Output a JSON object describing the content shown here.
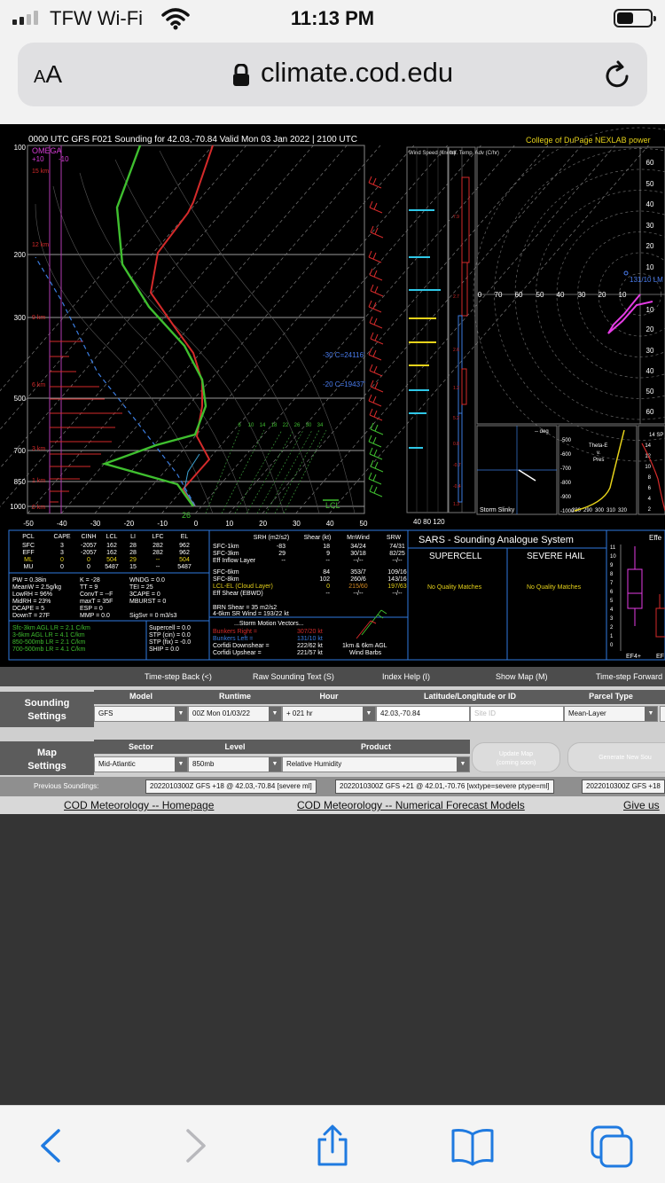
{
  "status_bar": {
    "carrier": "TFW Wi-Fi",
    "time": "11:13 PM",
    "icons": [
      "cellular-signal-icon",
      "wifi-icon",
      "battery-icon"
    ]
  },
  "browser": {
    "text_size_label_small": "A",
    "text_size_label_large": "A",
    "url": "climate.cod.edu",
    "icons": [
      "lock-icon",
      "reload-icon"
    ]
  },
  "sounding": {
    "title": "0000 UTC GFS F021 Sounding for 42.03,-70.84 Valid  Mon 03 Jan 2022 | 2100 UTC",
    "credit": "College of DuPage NEXLAB power",
    "omega_label": "OMEGA",
    "omega_scale": [
      "+10",
      "-10"
    ],
    "height_labels": [
      "15 km",
      "12 km",
      "9 km",
      "6 km",
      "3 km",
      "1 km",
      "0 km"
    ],
    "pressure_labels": [
      "100",
      "200",
      "300",
      "500",
      "700",
      "850",
      "1000"
    ],
    "temp_axis_labels": [
      "-50",
      "-40",
      "-30",
      "-20",
      "-10",
      "0",
      "10",
      "20",
      "30",
      "40",
      "50"
    ],
    "surface_temp": "26",
    "lcl_label": "LCL",
    "levels": [
      "-30 C=24116'",
      "-20 C=19437'"
    ],
    "mixing_ratio_labels": [
      "6",
      "10",
      "14",
      "18",
      "22",
      "26",
      "30",
      "34"
    ],
    "wind_speed_header": "Wind Speed (knots)",
    "wind_speed_axis": "40  80 120",
    "temp_adv_header": "Inf. Temp. Adv (C/hr)",
    "temp_adv_values": [
      "7.9",
      "2.7",
      "2.6",
      "1.2",
      "5.2",
      "0.8",
      "-0.7",
      "-0.4",
      "1.3"
    ],
    "hodograph_ring_labels_right": [
      "60",
      "50",
      "40",
      "30",
      "20",
      "10",
      "10",
      "20",
      "30",
      "40",
      "50",
      "60"
    ],
    "hodograph_ring_labels_left": [
      "0",
      "70",
      "60",
      "50",
      "40",
      "30",
      "20",
      "10"
    ],
    "hodograph_vector_label": "131/10 LM",
    "storm_slinky_label": "Storm Slinky",
    "deg_label": "-- deg",
    "theta_label": [
      "Theta-E",
      "v.",
      "Pres"
    ],
    "theta_pressures": [
      "-500",
      "-600",
      "-700",
      "-800",
      "-900",
      "-1000"
    ],
    "theta_axis": [
      "280",
      "290",
      "300",
      "310",
      "320"
    ]
  },
  "params": {
    "parcel_header": [
      "PCL",
      "CAPE",
      "CINH",
      "LCL",
      "LI",
      "LFC",
      "EL"
    ],
    "parcel_rows": [
      [
        "SFC",
        "3",
        "-2057",
        "162",
        "28",
        "282",
        "962"
      ],
      [
        "EFF",
        "3",
        "-2057",
        "162",
        "28",
        "282",
        "962"
      ],
      [
        "ML",
        "0",
        "0",
        "504",
        "29",
        "--",
        "504"
      ],
      [
        "MU",
        "0",
        "0",
        "5487",
        "15",
        "--",
        "5487"
      ]
    ],
    "thermo_col1": [
      "PW = 0.38in",
      "MeanW = 2.5g/kg",
      "LowRH = 96%",
      "MidRH = 23%",
      "DCAPE = 5",
      "DownT = 27F"
    ],
    "thermo_col2": [
      "K = -28",
      "TT = 9",
      "ConvT = --F",
      "maxT = 35F",
      "ESP = 0",
      "MMP = 0.0"
    ],
    "thermo_col3": [
      "WNDG = 0.0",
      "TEI = 25",
      "3CAPE = 0",
      "MBURST = 0",
      "",
      "SigSvr = 0 m3/s3"
    ],
    "lapse_rates": [
      "Sfc-3km AGL LR = 2.1 C/km",
      "3-6km AGL LR = 4.1 C/km",
      "850-500mb LR = 2.1 C/km",
      "700-500mb LR = 4.1 C/km"
    ],
    "composite": [
      "Supercell = 0.0",
      "STP (cin) = 0.0",
      "STP (fix) = -0.0",
      "SHIP = 0.0"
    ],
    "kin_header": [
      "SRH (m2/s2)",
      "Shear (kt)",
      "MnWind",
      "SRW"
    ],
    "kin_rows": [
      [
        "SFC-1km",
        "-83",
        "18",
        "34/24",
        "74/31"
      ],
      [
        "SFC-3km",
        "29",
        "9",
        "30/18",
        "82/25"
      ],
      [
        "Eff Inflow Layer",
        "--",
        "--",
        "--/--",
        "--/--"
      ],
      [
        "SFC-6km",
        "",
        "84",
        "353/7",
        "109/16"
      ],
      [
        "SFC-8km",
        "",
        "102",
        "260/6",
        "143/16"
      ],
      [
        "LCL-EL (Cloud Layer)",
        "",
        "0",
        "215/60",
        "197/63"
      ],
      [
        "Eff Shear (EBWD)",
        "",
        "--",
        "--/--",
        "--/--"
      ]
    ],
    "brn_shear": "BRN Shear =        35 m2/s2",
    "sr_wind": "4-6km SR Wind =     193/22 kt",
    "storm_motion_header": "...Storm Motion Vectors...",
    "bunkers_right": [
      "Bunkers Right =",
      "307/20 kt"
    ],
    "bunkers_left": [
      "Bunkers Left =",
      "131/10 kt"
    ],
    "corfidi_down": [
      "Corfidi Downshear =",
      "222/62 kt"
    ],
    "corfidi_up": [
      "Corfidi Upshear =",
      "221/57 kt"
    ],
    "wind_barbs_label": [
      "1km & 6km AGL",
      "Wind Barbs"
    ],
    "sars_title": "SARS - Sounding Analogue System",
    "sars_supercell": "SUPERCELL",
    "sars_hail": "SEVERE HAIL",
    "sars_no_match": "No Quality Matches",
    "boxplot_title": "Effe",
    "boxplot_axis": [
      "11",
      "10",
      "9",
      "8",
      "7",
      "6",
      "5",
      "4",
      "3",
      "2",
      "1",
      "0"
    ],
    "boxplot_labels": [
      "EF4+",
      "EF"
    ],
    "hail_axis": [
      "14",
      "12",
      "10",
      "8",
      "6",
      "4",
      "2"
    ],
    "hail_label": "14 SP"
  },
  "controls": {
    "nav": [
      "Time-step Back (<)",
      "Raw Sounding Text (S)",
      "Index Help (I)",
      "Show Map (M)",
      "Time-step Forward"
    ],
    "sounding_settings_label": [
      "Sounding",
      "Settings"
    ],
    "sounding_cols": [
      "Model",
      "Runtime",
      "Hour",
      "Latitude/Longitude or ID",
      "Parcel Type"
    ],
    "model_value": "GFS",
    "runtime_value": "00Z Mon 01/03/22",
    "hour_value": "+ 021 hr",
    "latlon_value": "42.03,-70.84",
    "site_id_placeholder": "Site ID",
    "parcel_value": "Mean-Layer",
    "map_settings_label": [
      "Map",
      "Settings"
    ],
    "map_cols": [
      "Sector",
      "Level",
      "Product"
    ],
    "sector_value": "Mid-Atlantic",
    "level_value": "850mb",
    "product_value": "Relative Humidity",
    "update_map": [
      "Update Map",
      "(coming soon)"
    ],
    "generate": "Generate New Sou",
    "previous_label": "Previous Soundings:",
    "previous": [
      "2022010300Z GFS +18 @ 42.03,-70.84 [severe ml]",
      "2022010300Z GFS +21 @ 42.01,-70.76 [wxtype=severe ptype=ml]",
      "2022010300Z GFS +18"
    ],
    "footer_links": [
      "COD Meteorology -- Homepage",
      "COD Meteorology -- Numerical Forecast Models",
      "Give us"
    ]
  },
  "toolbar": {
    "icons": [
      "back-arrow-icon",
      "forward-arrow-icon",
      "share-icon",
      "bookmarks-icon",
      "tabs-icon"
    ]
  },
  "colors": {
    "ios_blue": "#1f7ae0",
    "temp_trace": "#d42a2a",
    "dewpoint_trace": "#3fbf2f",
    "hodograph_pink": "#e43ce4",
    "credit_yellow": "#e6d21a"
  }
}
